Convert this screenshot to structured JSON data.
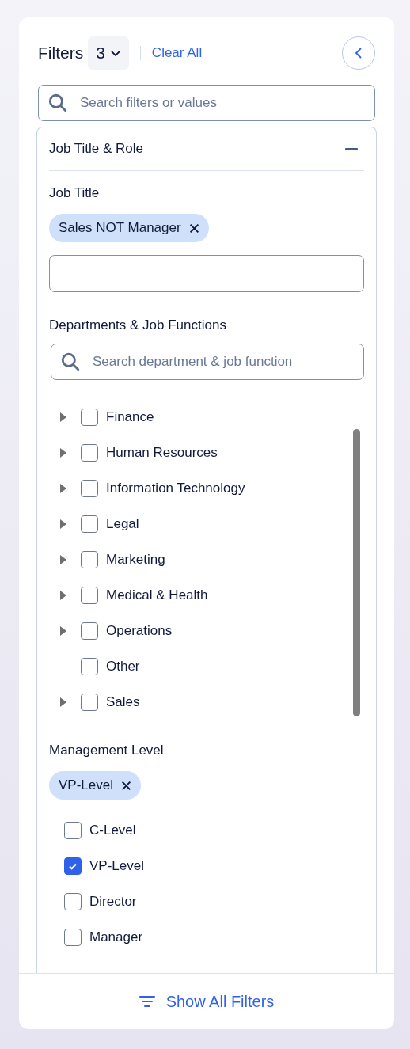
{
  "header": {
    "title": "Filters",
    "count": "3",
    "clear": "Clear All"
  },
  "search": {
    "placeholder": "Search filters or values"
  },
  "section": {
    "title": "Job Title & Role",
    "expanded": true,
    "job_title": {
      "label": "Job Title",
      "chips": [
        "Sales NOT Manager"
      ]
    },
    "departments": {
      "label": "Departments & Job Functions",
      "placeholder": "Search department & job function",
      "items": [
        {
          "label": "Finance",
          "checked": false,
          "expandable": true
        },
        {
          "label": "Human Resources",
          "checked": false,
          "expandable": true
        },
        {
          "label": "Information Technology",
          "checked": false,
          "expandable": true
        },
        {
          "label": "Legal",
          "checked": false,
          "expandable": true
        },
        {
          "label": "Marketing",
          "checked": false,
          "expandable": true
        },
        {
          "label": "Medical & Health",
          "checked": false,
          "expandable": true
        },
        {
          "label": "Operations",
          "checked": false,
          "expandable": true
        },
        {
          "label": "Other",
          "checked": false,
          "expandable": false
        },
        {
          "label": "Sales",
          "checked": false,
          "expandable": true
        }
      ]
    },
    "management": {
      "label": "Management Level",
      "chips": [
        "VP-Level"
      ],
      "items": [
        {
          "label": "C-Level",
          "checked": false
        },
        {
          "label": "VP-Level",
          "checked": true
        },
        {
          "label": "Director",
          "checked": false
        },
        {
          "label": "Manager",
          "checked": false
        }
      ]
    }
  },
  "footer": {
    "button": "Show All Filters"
  }
}
